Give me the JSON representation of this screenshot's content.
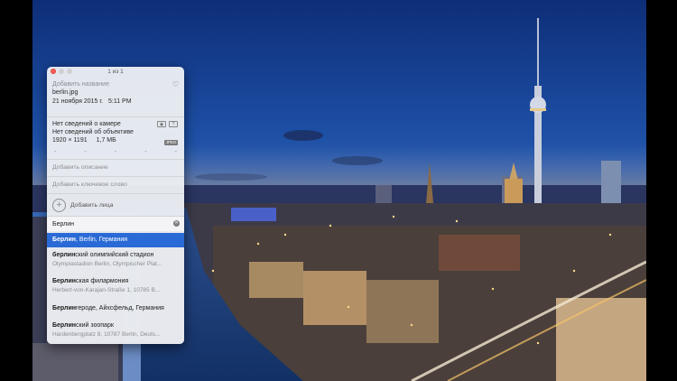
{
  "window": {
    "title": "1 из 1"
  },
  "info": {
    "name_placeholder": "Добавить название",
    "filename": "berlin.jpg",
    "date": "21 ноября 2015 г.",
    "time": "5:11 PM"
  },
  "camera": {
    "camera_text": "Нет сведений о камере",
    "lens_text": "Нет сведений об объективе",
    "dimensions": "1920 × 1191",
    "size": "1,7 МБ",
    "format_badge": "JPEG",
    "dashes": [
      "-",
      "-",
      "-",
      "-",
      "-"
    ]
  },
  "fields": {
    "description_placeholder": "Добавить описание",
    "keyword_placeholder": "Добавить ключевое слово",
    "add_faces": "Добавить лица"
  },
  "location_search": {
    "value": "Берлин"
  },
  "results": [
    {
      "bold": "Берлин",
      "rest": ", Berlin, Германия",
      "subtitle": ""
    },
    {
      "bold": "берлин",
      "rest": "ский олимпийский стадион",
      "subtitle": "Olympiastadion Berlin, Olympischer Plat..."
    },
    {
      "bold": "Берлин",
      "rest": "ская филармония",
      "subtitle": "Herbert-von-Karajan-Straße 1, 10785 B..."
    },
    {
      "bold": "Берлин",
      "rest": "героде, Айхсфельд, Германия",
      "subtitle": ""
    },
    {
      "bold": "Берлин",
      "rest": "ский зоопарк",
      "subtitle": "Hardenbergplatz 8, 10787 Berlin, Deuts..."
    }
  ],
  "colors": {
    "selection": "#2a6ad6",
    "close_button": "#fc5f57"
  },
  "icons": [
    "heart-icon",
    "camera-icon",
    "question-icon",
    "plus-icon",
    "clear-icon"
  ]
}
